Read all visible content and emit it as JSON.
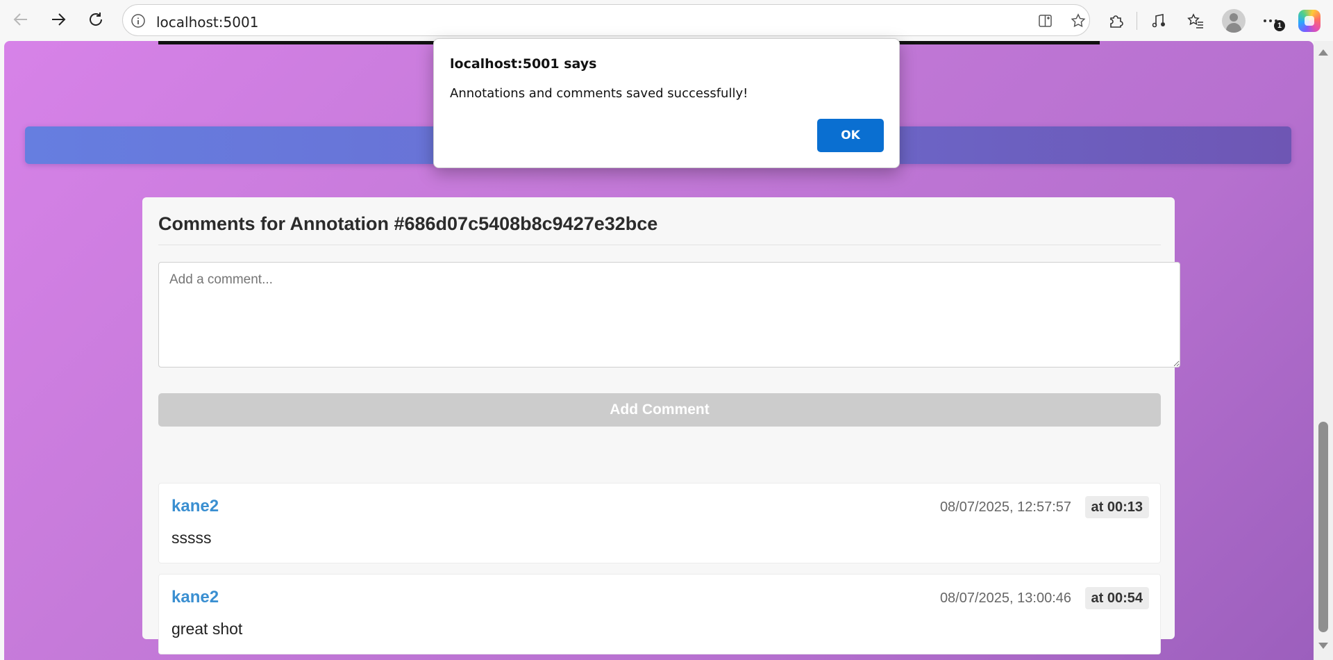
{
  "browser": {
    "url": "localhost:5001",
    "icons": {
      "back": "arrow-left-icon",
      "forward": "arrow-right-icon",
      "reload": "reload-icon",
      "site_info": "info-icon",
      "split_screen": "split-screen-icon",
      "favorite": "star-icon",
      "extensions": "puzzle-icon",
      "media": "music-note-icon",
      "favorites_bar": "favorites-list-icon",
      "profile": "profile-avatar-icon",
      "more": "more-dots-icon",
      "copilot": "copilot-icon"
    },
    "notification_badge": "1"
  },
  "dialog": {
    "title": "localhost:5001 says",
    "message": "Annotations and comments saved successfully!",
    "ok_label": "OK"
  },
  "comments_panel": {
    "title": "Comments for Annotation #686d07c5408b8c9427e32bce",
    "input_placeholder": "Add a comment...",
    "add_button_label": "Add Comment",
    "comments": [
      {
        "user": "kane2",
        "date": "08/07/2025, 12:57:57",
        "timestamp": "at 00:13",
        "text": "sssss"
      },
      {
        "user": "kane2",
        "date": "08/07/2025, 13:00:46",
        "timestamp": "at 00:54",
        "text": "great shot"
      }
    ]
  },
  "colors": {
    "accent_ok": "#0a6fd1",
    "username": "#3a8fd1",
    "page_gradient_start": "#d782e8",
    "page_gradient_end": "#9c5fbd",
    "header_strip_start": "#667ee0",
    "header_strip_end": "#6e56b4",
    "disabled_button": "#cccccc"
  }
}
